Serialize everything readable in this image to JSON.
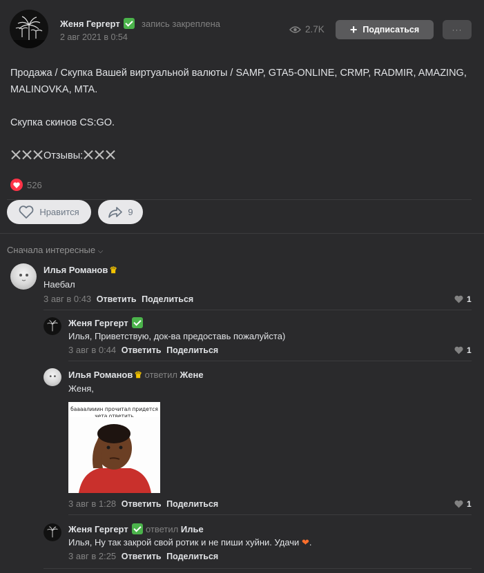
{
  "post": {
    "author": "Женя Гергерт",
    "pinned_label": "запись закреплена",
    "date": "2 авг 2021 в 0:54",
    "views": "2.7K",
    "subscribe_label": "Подписаться",
    "more_label": "···",
    "text_line1": "Продажа / Скупка Вашей виртуальной валюты / SAMP, GTA5-ONLINE, CRMP, RADMIR, AMAZING, MALINOVKA, MTA.",
    "text_line2": "Скупка скинов CS:GO.",
    "text_line3": "Отзывы:",
    "likes_count": "526",
    "like_button_label": "Нравится",
    "share_count": "9"
  },
  "comments": {
    "sort_label": "Сначала интересные",
    "items": [
      {
        "name": "Илья Романов",
        "text": "Наебал",
        "time": "3 авг в 0:43",
        "reply": "Ответить",
        "share": "Поделиться",
        "likes": "1"
      },
      {
        "name": "Женя Гергерт",
        "text": "Илья, Приветствую, док-ва предоставь пожалуйста)",
        "time": "3 авг в 0:44",
        "reply": "Ответить",
        "share": "Поделиться",
        "likes": "1"
      },
      {
        "name": "Илья Романов",
        "replied_label": "ответил",
        "replied_to": "Жене",
        "text": "Женя,",
        "meme_caption": "баааалииин прочитал придется чета ответить",
        "time": "3 авг в 1:28",
        "reply": "Ответить",
        "share": "Поделиться",
        "likes": "1"
      },
      {
        "name": "Женя Гергерт",
        "replied_label": "ответил",
        "replied_to": "Илье",
        "text": "Илья, Ну так закрой свой ротик и не пиши хуйни. Удачи",
        "text_end": ".",
        "time": "3 авг в 2:25",
        "reply": "Ответить",
        "share": "Поделиться"
      }
    ]
  },
  "colors": {
    "background": "#2a2a2c",
    "text": "#e1e3e6",
    "secondary": "#828282",
    "verified": "#4bb34b",
    "like_red": "#ff3347"
  }
}
